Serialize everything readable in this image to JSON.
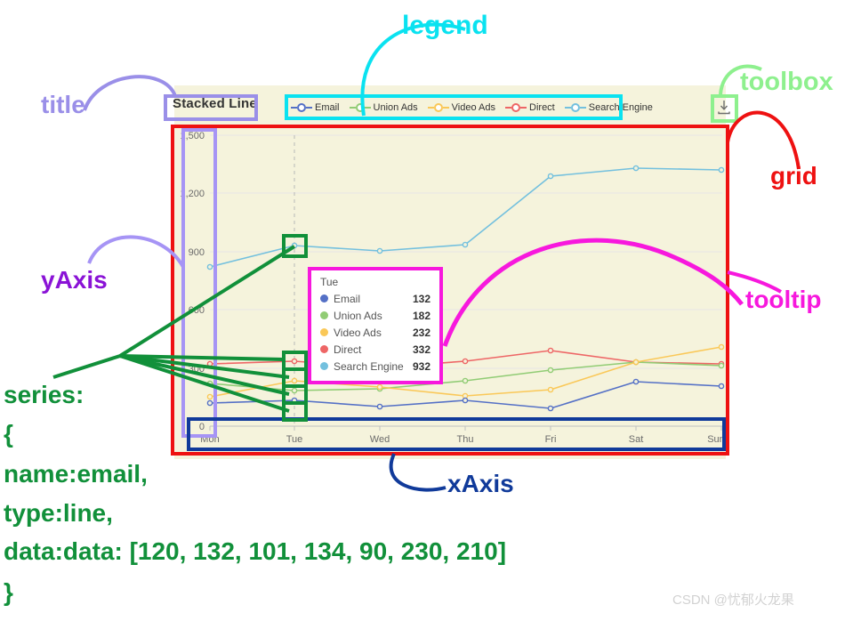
{
  "chart": {
    "title": "Stacked Line",
    "toolbox_icon": "download-icon",
    "background": "#f5f3dc"
  },
  "chart_data": {
    "type": "line",
    "title": "Stacked Line",
    "categories": [
      "Mon",
      "Tue",
      "Wed",
      "Thu",
      "Fri",
      "Sat",
      "Sun"
    ],
    "xlabel": "",
    "ylabel": "",
    "ylim": [
      0,
      1500
    ],
    "yticks": [
      0,
      300,
      600,
      900,
      1200,
      1500
    ],
    "ytick_labels": [
      "0",
      "300",
      "600",
      "900",
      "1,200",
      "1,500"
    ],
    "grid": true,
    "legend_position": "top",
    "series": [
      {
        "name": "Email",
        "color": "#5470c6",
        "values": [
          120,
          132,
          101,
          134,
          90,
          230,
          210
        ]
      },
      {
        "name": "Union Ads",
        "color": "#91cc75",
        "values": [
          220,
          182,
          191,
          234,
          290,
          330,
          310
        ]
      },
      {
        "name": "Video Ads",
        "color": "#fac858",
        "values": [
          150,
          232,
          201,
          154,
          190,
          330,
          410
        ]
      },
      {
        "name": "Direct",
        "color": "#ee6666",
        "values": [
          320,
          332,
          301,
          334,
          390,
          330,
          320
        ]
      },
      {
        "name": "Search Engine",
        "color": "#73c0de",
        "values": [
          820,
          932,
          901,
          934,
          1290,
          1330,
          1320
        ]
      }
    ]
  },
  "legend": {
    "items": [
      {
        "label": "Email",
        "color": "#5470c6"
      },
      {
        "label": "Union Ads",
        "color": "#91cc75"
      },
      {
        "label": "Video Ads",
        "color": "#fac858"
      },
      {
        "label": "Direct",
        "color": "#ee6666"
      },
      {
        "label": "Search Engine",
        "color": "#73c0de"
      }
    ]
  },
  "tooltip": {
    "title": "Tue",
    "rows": [
      {
        "name": "Email",
        "value": "132",
        "color": "#5470c6"
      },
      {
        "name": "Union Ads",
        "value": "182",
        "color": "#91cc75"
      },
      {
        "name": "Video Ads",
        "value": "232",
        "color": "#fac858"
      },
      {
        "name": "Direct",
        "value": "332",
        "color": "#ee6666"
      },
      {
        "name": "Search Engine",
        "value": "932",
        "color": "#73c0de"
      }
    ]
  },
  "annotations": {
    "title": {
      "text": "title",
      "color": "#9a8fe8"
    },
    "legend": {
      "text": "legend",
      "color": "#0ae2f0"
    },
    "toolbox": {
      "text": "toolbox",
      "color": "#8ef08e"
    },
    "grid": {
      "text": "grid",
      "color": "#ee1111"
    },
    "tooltip": {
      "text": "tooltip",
      "color": "#f718dd"
    },
    "yaxis": {
      "text": "yAxis",
      "color": "#8a13d6"
    },
    "xaxis": {
      "text": "xAxis",
      "color": "#103a9a"
    }
  },
  "code": {
    "line1": "series:",
    "line2": "{",
    "line3": "name:email,",
    "line4": "type:line,",
    "line5": "data:data: [120, 132, 101, 134, 90, 230, 210]",
    "line6": "}",
    "color": "#11903a"
  },
  "watermark": "CSDN @忧郁火龙果"
}
